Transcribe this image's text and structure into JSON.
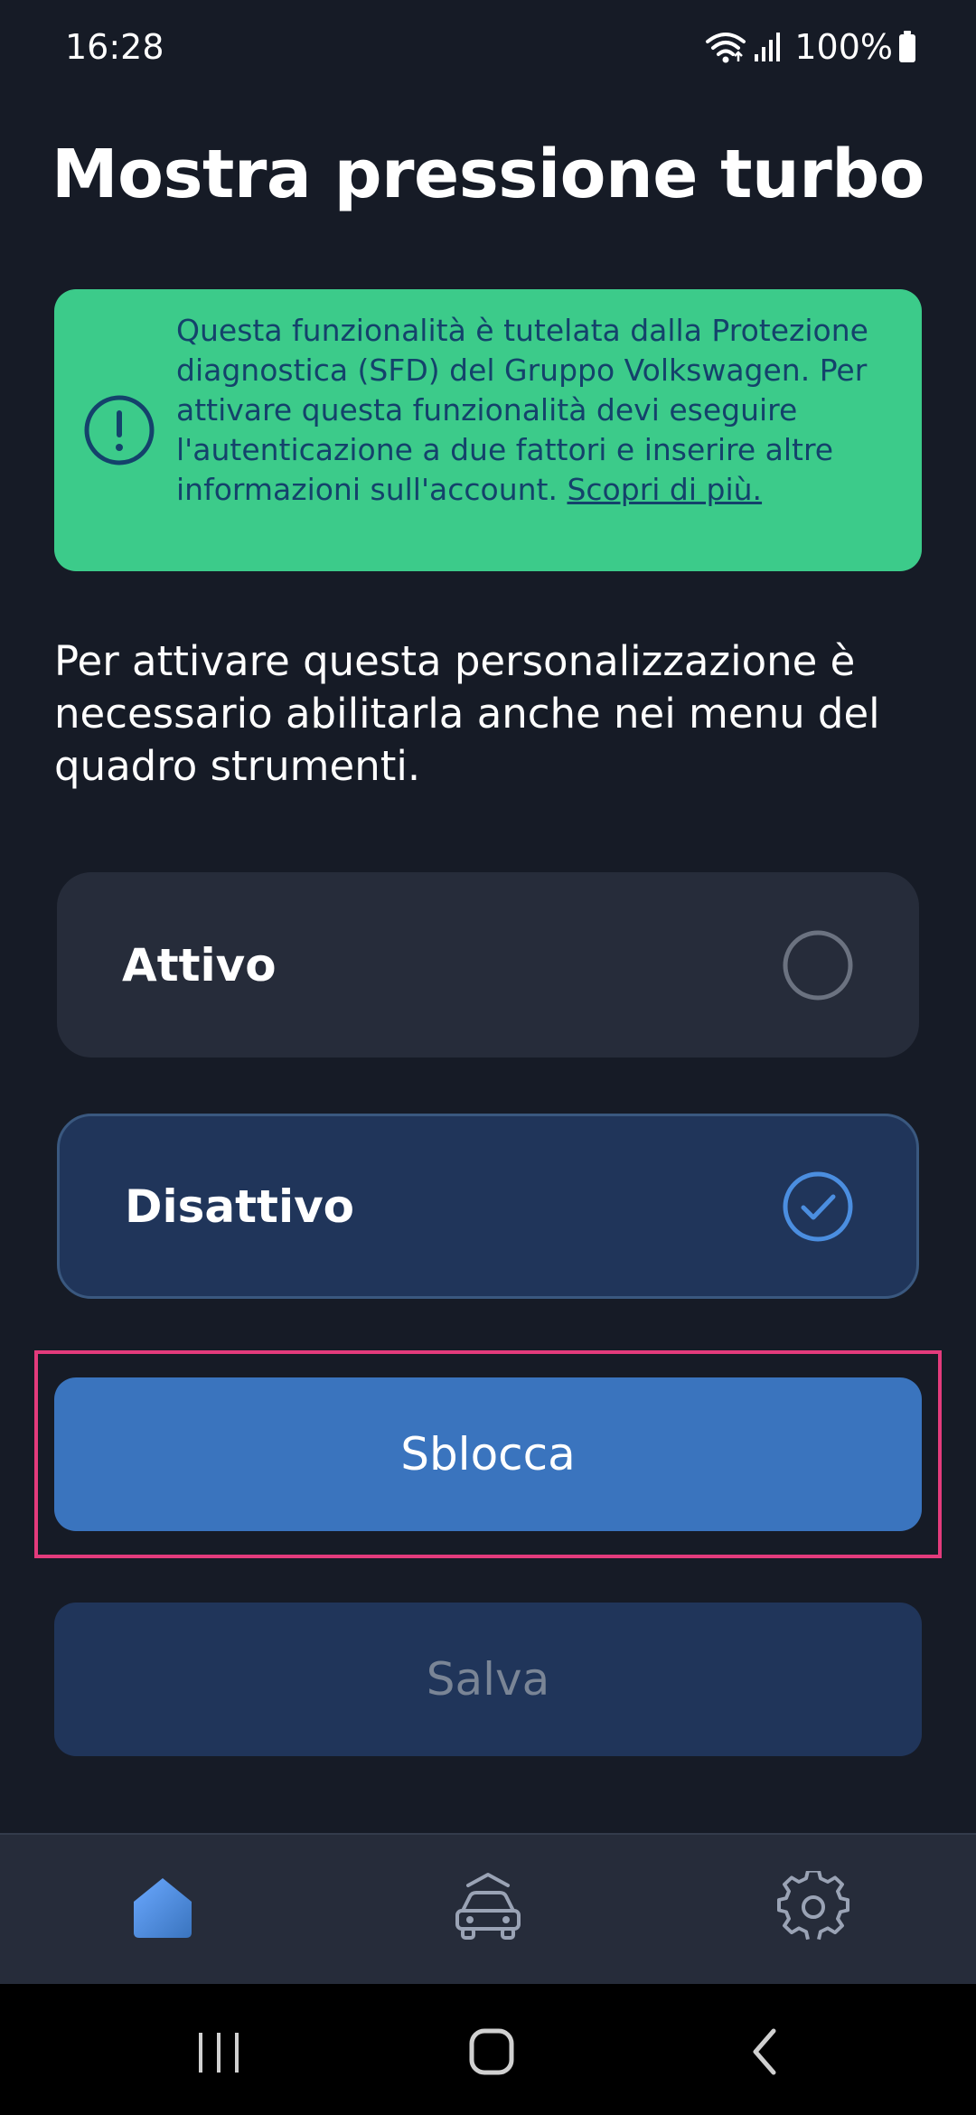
{
  "status_bar": {
    "time": "16:28",
    "battery": "100%",
    "icons": [
      "wifi-icon",
      "signal-icon",
      "battery-icon"
    ]
  },
  "page": {
    "title": "Mostra pressione turbo"
  },
  "info_banner": {
    "text": "Questa funzionalità è tutelata dalla Protezione diagnostica (SFD) del Gruppo Volkswagen. Per attivare questa funzionalità devi eseguire l'autenticazione a due fattori e inserire altre informazioni sull'account. ",
    "link_text": "Scopri di più.",
    "icon": "info-exclamation-icon",
    "background_color": "#3ccb8a",
    "text_color": "#14426b"
  },
  "description": "Per attivare questa personalizzazione è necessario abilitarla anche nei menu del quadro strumenti.",
  "options": [
    {
      "label": "Attivo",
      "selected": false
    },
    {
      "label": "Disattivo",
      "selected": true
    }
  ],
  "buttons": {
    "unlock": "Sblocca",
    "save": "Salva"
  },
  "bottom_nav": {
    "items": [
      {
        "icon": "home-icon",
        "active": true
      },
      {
        "icon": "car-icon",
        "active": false
      },
      {
        "icon": "gear-icon",
        "active": false
      }
    ]
  },
  "system_nav": {
    "icons": [
      "recents-icon",
      "home-circle-icon",
      "back-icon"
    ]
  },
  "colors": {
    "background": "#161b26",
    "accent": "#3a74be",
    "highlight": "#e33b7c",
    "selected_border": "#3a587f"
  }
}
